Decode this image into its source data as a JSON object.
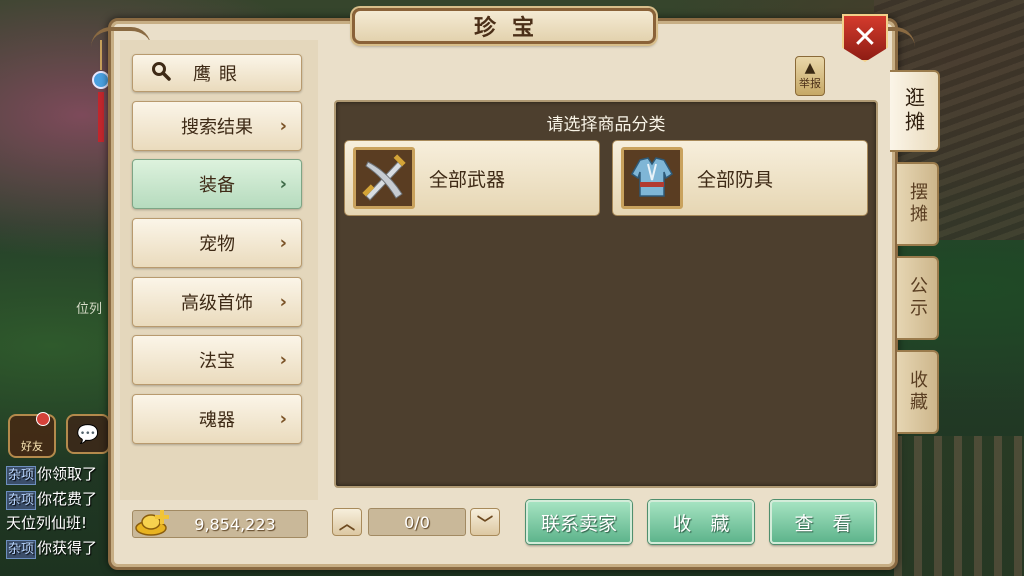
{
  "window": {
    "title": "珍宝",
    "close_icon": "close-x-icon"
  },
  "search": {
    "label": "鹰眼",
    "icon": "magnifier-icon"
  },
  "categories": [
    {
      "label": "搜索结果",
      "active": false
    },
    {
      "label": "装备",
      "active": true
    },
    {
      "label": "宠物",
      "active": false
    },
    {
      "label": "高级首饰",
      "active": false
    },
    {
      "label": "法宝",
      "active": false
    },
    {
      "label": "魂器",
      "active": false
    }
  ],
  "report": {
    "label": "举报"
  },
  "content": {
    "title": "请选择商品分类",
    "items": [
      {
        "label": "全部武器",
        "icon": "crossed-swords-icon"
      },
      {
        "label": "全部防具",
        "icon": "armor-icon"
      }
    ]
  },
  "currency": {
    "amount": "9,854,223",
    "icon": "gold-ingot-icon"
  },
  "pager": {
    "value": "0/0",
    "up_icon": "chevron-up-icon",
    "down_icon": "chevron-down-icon"
  },
  "actions": {
    "contact_seller": "联系卖家",
    "favorite": "收　藏",
    "view": "查　看"
  },
  "side_tabs": [
    {
      "label": "逛摊",
      "active": true
    },
    {
      "label": "摆摊",
      "active": false
    },
    {
      "label": "公示",
      "active": false
    },
    {
      "label": "收藏",
      "active": false
    }
  ],
  "hud": {
    "friend_label": "好友",
    "background_text": "位列",
    "chat": [
      {
        "tag": "杂项",
        "text": "你领取了"
      },
      {
        "tag": "杂项",
        "text": "你花费了"
      },
      {
        "tag": "",
        "text": "天位列仙班!"
      },
      {
        "tag": "杂项",
        "text": "你获得了"
      }
    ]
  },
  "colors": {
    "accent_green": "#5eb48c",
    "frame_brown": "#8a6a42",
    "panel_dark": "#4d3f2e",
    "close_red": "#d43b2d"
  }
}
